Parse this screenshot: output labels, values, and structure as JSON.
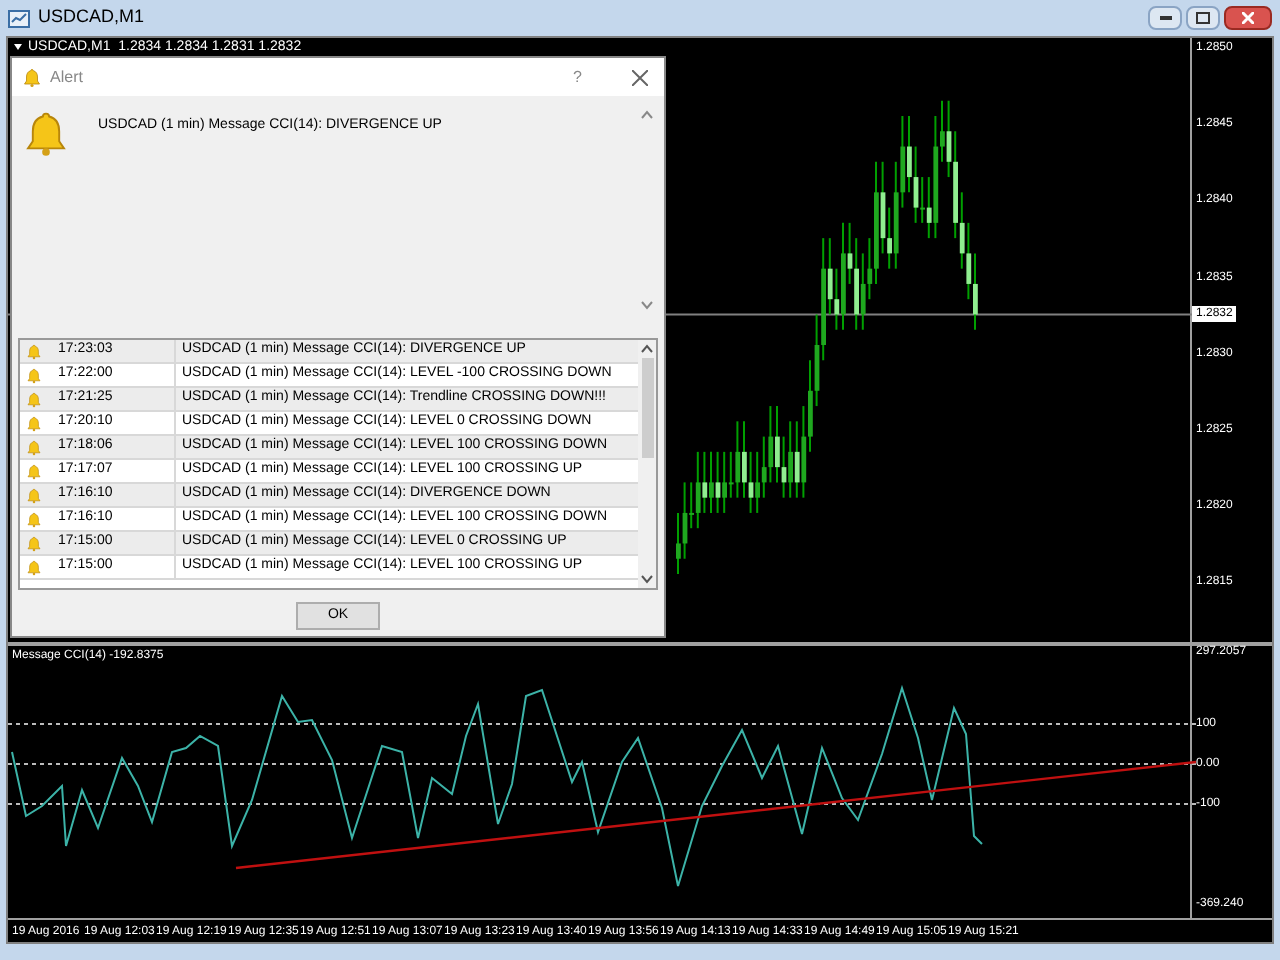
{
  "window": {
    "title": "USDCAD,M1"
  },
  "chart": {
    "header": "USDCAD,M1  1.2834 1.2834 1.2831 1.2832",
    "price_labels": [
      "1.2850",
      "1.2845",
      "1.2840",
      "1.2835",
      "1.2830",
      "1.2825",
      "1.2820",
      "1.2815"
    ],
    "current_price": "1.2832"
  },
  "indicator": {
    "label": "Message CCI(14) -192.8375",
    "axis_labels": [
      "297.2057",
      "100",
      "0.00",
      "-100",
      "-369.240"
    ]
  },
  "time_labels": [
    "19 Aug 2016",
    "19 Aug 12:03",
    "19 Aug 12:19",
    "19 Aug 12:35",
    "19 Aug 12:51",
    "19 Aug 13:07",
    "19 Aug 13:23",
    "19 Aug 13:40",
    "19 Aug 13:56",
    "19 Aug 14:13",
    "19 Aug 14:33",
    "19 Aug 14:49",
    "19 Aug 15:05",
    "19 Aug 15:21"
  ],
  "alert": {
    "title": "Alert",
    "help": "?",
    "message": "USDCAD (1 min) Message CCI(14): DIVERGENCE UP",
    "rows": [
      {
        "time": "17:23:03",
        "message": "USDCAD (1 min) Message CCI(14): DIVERGENCE UP"
      },
      {
        "time": "17:22:00",
        "message": "USDCAD (1 min) Message CCI(14): LEVEL -100 CROSSING DOWN"
      },
      {
        "time": "17:21:25",
        "message": "USDCAD (1 min) Message CCI(14): Trendline CROSSING DOWN!!!"
      },
      {
        "time": "17:20:10",
        "message": "USDCAD (1 min) Message CCI(14): LEVEL 0 CROSSING DOWN"
      },
      {
        "time": "17:18:06",
        "message": "USDCAD (1 min) Message CCI(14): LEVEL 100 CROSSING DOWN"
      },
      {
        "time": "17:17:07",
        "message": "USDCAD (1 min) Message CCI(14): LEVEL 100 CROSSING UP"
      },
      {
        "time": "17:16:10",
        "message": "USDCAD (1 min) Message CCI(14): DIVERGENCE DOWN"
      },
      {
        "time": "17:16:10",
        "message": "USDCAD (1 min) Message CCI(14): LEVEL 100 CROSSING DOWN"
      },
      {
        "time": "17:15:00",
        "message": "USDCAD (1 min) Message CCI(14): LEVEL 0 CROSSING UP"
      },
      {
        "time": "17:15:00",
        "message": "USDCAD (1 min) Message CCI(14): LEVEL 100 CROSSING UP"
      }
    ],
    "ok": "OK"
  }
}
